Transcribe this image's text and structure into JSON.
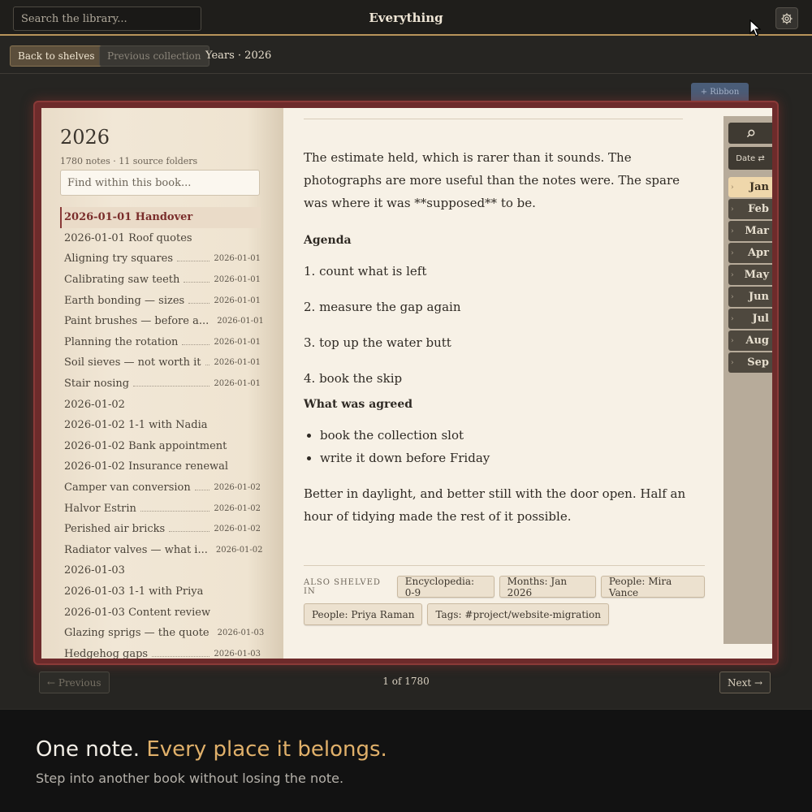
{
  "topbar": {
    "search_placeholder": "Search the library...",
    "title": "Everything",
    "settings_icon": "gear-icon"
  },
  "subbar": {
    "back_label": "Back to shelves",
    "prev_collection_label": "Previous collection",
    "breadcrumb": "Years · 2026"
  },
  "ribbon": {
    "label": "+ Ribbon"
  },
  "book": {
    "title": "2026",
    "meta": "1780 notes · 11 source folders",
    "find_placeholder": "Find within this book...",
    "notes": [
      {
        "title": "2026-01-01 Handover",
        "date": "",
        "active": true
      },
      {
        "title": "2026-01-01 Roof quotes",
        "date": ""
      },
      {
        "title": "Aligning try squares",
        "date": "2026-01-01"
      },
      {
        "title": "Calibrating saw teeth",
        "date": "2026-01-01"
      },
      {
        "title": "Earth bonding — sizes",
        "date": "2026-01-01"
      },
      {
        "title": "Paint brushes — before a...",
        "date": "2026-01-01"
      },
      {
        "title": "Planning the rotation",
        "date": "2026-01-01"
      },
      {
        "title": "Soil sieves — not worth it",
        "date": "2026-01-01"
      },
      {
        "title": "Stair nosing",
        "date": "2026-01-01"
      },
      {
        "title": "2026-01-02",
        "date": ""
      },
      {
        "title": "2026-01-02 1-1 with Nadia",
        "date": ""
      },
      {
        "title": "2026-01-02 Bank appointment",
        "date": ""
      },
      {
        "title": "2026-01-02 Insurance renewal",
        "date": ""
      },
      {
        "title": "Camper van conversion",
        "date": "2026-01-02"
      },
      {
        "title": "Halvor Estrin",
        "date": "2026-01-02"
      },
      {
        "title": "Perished air bricks",
        "date": "2026-01-02"
      },
      {
        "title": "Radiator valves — what i...",
        "date": "2026-01-02"
      },
      {
        "title": "2026-01-03",
        "date": ""
      },
      {
        "title": "2026-01-03 1-1 with Priya",
        "date": ""
      },
      {
        "title": "2026-01-03 Content review",
        "date": ""
      },
      {
        "title": "Glazing sprigs — the quote",
        "date": "2026-01-03"
      },
      {
        "title": "Hedgehog gaps",
        "date": "2026-01-03"
      }
    ],
    "note": {
      "intro": "The estimate held, which is rarer than it sounds. The photographs are more useful than the notes were. The spare was where it was **supposed** to be.",
      "agenda_heading": "Agenda",
      "agenda": [
        "1. count what is left",
        "2. measure the gap again",
        "3. top up the water butt",
        "4. book the skip"
      ],
      "agreed_heading": "What was agreed",
      "agreed": [
        "book the collection slot",
        "write it down before Friday"
      ],
      "closing": "Better in daylight, and better still with the door open. Half an hour of tidying made the rest of it possible."
    },
    "shelved": {
      "label": "ALSO SHELVED IN",
      "chips": [
        "Encyclopedia: 0-9",
        "Months: Jan 2026",
        "People: Mira Vance",
        "People: Priya Raman",
        "Tags: #project/website-migration"
      ]
    },
    "rail": {
      "search_icon": "search-icon",
      "date_label": "Date ⇄",
      "months": [
        {
          "label": "Jan",
          "active": true
        },
        {
          "label": "Feb"
        },
        {
          "label": "Mar"
        },
        {
          "label": "Apr"
        },
        {
          "label": "May"
        },
        {
          "label": "Jun"
        },
        {
          "label": "Jul"
        },
        {
          "label": "Aug"
        },
        {
          "label": "Sep"
        }
      ]
    }
  },
  "pager": {
    "prev_label": "← Previous",
    "count": "1 of 1780",
    "next_label": "Next →"
  },
  "promo": {
    "head_plain": "One note. ",
    "head_accent": "Every place it belongs.",
    "sub": "Step into another book without losing the note."
  }
}
